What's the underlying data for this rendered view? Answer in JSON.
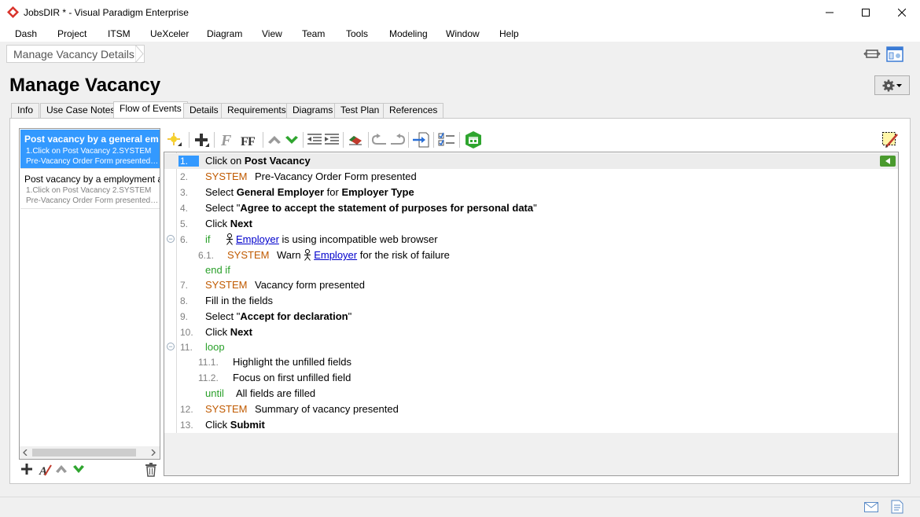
{
  "window": {
    "title": "JobsDIR * - Visual Paradigm Enterprise",
    "controls": [
      "minimize-icon",
      "maximize-icon",
      "close-icon"
    ]
  },
  "menu": [
    "Dash",
    "Project",
    "ITSM",
    "UeXceler",
    "Diagram",
    "View",
    "Team",
    "Tools",
    "Modeling",
    "Window",
    "Help"
  ],
  "breadcrumb": {
    "label": "Manage Vacancy Details"
  },
  "page": {
    "title": "Manage Vacancy"
  },
  "tabs": [
    {
      "label": "Info",
      "active": false
    },
    {
      "label": "Use Case Notes",
      "active": false
    },
    {
      "label": "Flow of Events",
      "active": true
    },
    {
      "label": "Details",
      "active": false
    },
    {
      "label": "Requirements",
      "active": false
    },
    {
      "label": "Diagrams",
      "active": false
    },
    {
      "label": "Test Plan",
      "active": false
    },
    {
      "label": "References",
      "active": false
    }
  ],
  "scenarios": [
    {
      "title": "Post vacancy by a general em…",
      "line1": "1.Click on Post Vacancy 2.SYSTEM",
      "line2": "Pre-Vacancy Order Form presented…",
      "selected": true
    },
    {
      "title": "Post vacancy by a employment ager",
      "line1": "1.Click on Post Vacancy 2.SYSTEM",
      "line2": "Pre-Vacancy Order Form presented…",
      "selected": false
    }
  ],
  "keywords": {
    "system": "SYSTEM",
    "if": "if",
    "end_if": "end if",
    "loop": "loop",
    "until": "until"
  },
  "steps": {
    "s1": {
      "num": "1.",
      "pre": "Click on ",
      "bold": "Post Vacancy"
    },
    "s2": {
      "num": "2.",
      "text": "Pre-Vacancy Order Form presented"
    },
    "s3": {
      "num": "3.",
      "pre": "Select ",
      "bold1": "General Employer",
      "mid": " for ",
      "bold2": "Employer Type"
    },
    "s4": {
      "num": "4.",
      "pre": "Select \"",
      "bold": "Agree to accept the statement of purposes for personal data",
      "post": "\""
    },
    "s5": {
      "num": "5.",
      "pre": "Click ",
      "bold": "Next"
    },
    "s6": {
      "num": "6.",
      "actor": "Employer",
      "post": " is using incompatible web browser"
    },
    "s61": {
      "num": "6.1.",
      "pre": "Warn ",
      "actor": "Employer",
      "post": " for the risk of failure"
    },
    "s7": {
      "num": "7.",
      "text": "Vacancy form presented"
    },
    "s8": {
      "num": "8.",
      "text": "Fill in the fields"
    },
    "s9": {
      "num": "9.",
      "pre": "Select \"",
      "bold": "Accept for declaration",
      "post": "\""
    },
    "s10": {
      "num": "10.",
      "pre": "Click ",
      "bold": "Next"
    },
    "s11": {
      "num": "11."
    },
    "s111": {
      "num": "11.1.",
      "text": "Highlight the unfilled fields"
    },
    "s112": {
      "num": "11.2.",
      "text": "Focus on first unfilled field"
    },
    "s_until": {
      "text": "All fields are filled"
    },
    "s12": {
      "num": "12.",
      "text": "Summary of vacancy presented"
    },
    "s13": {
      "num": "13.",
      "pre": "Click ",
      "bold": "Submit"
    }
  },
  "colors": {
    "selection": "#3399ff",
    "system_keyword": "#c05a00",
    "control_keyword": "#2aa02a",
    "actor_link": "#0000cc"
  }
}
